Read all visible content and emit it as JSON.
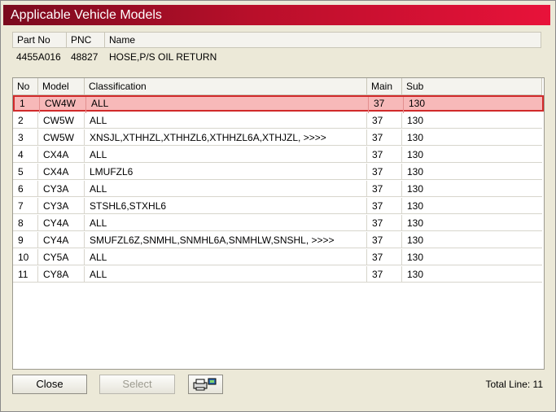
{
  "window": {
    "title": "Applicable Vehicle Models"
  },
  "part_info": {
    "headers": {
      "part_no": "Part No",
      "pnc": "PNC",
      "name": "Name"
    },
    "values": {
      "part_no": "4455A016",
      "pnc": "48827",
      "name": "HOSE,P/S OIL RETURN"
    }
  },
  "table": {
    "headers": {
      "no": "No",
      "model": "Model",
      "classification": "Classification",
      "main": "Main",
      "sub": "Sub"
    },
    "rows": [
      {
        "no": "1",
        "model": "CW4W",
        "classification": "ALL",
        "main": "37",
        "sub": "130"
      },
      {
        "no": "2",
        "model": "CW5W",
        "classification": "ALL",
        "main": "37",
        "sub": "130"
      },
      {
        "no": "3",
        "model": "CW5W",
        "classification": "XNSJL,XTHHZL,XTHHZL6,XTHHZL6A,XTHJZL,   >>>>",
        "main": "37",
        "sub": "130"
      },
      {
        "no": "4",
        "model": "CX4A",
        "classification": "ALL",
        "main": "37",
        "sub": "130"
      },
      {
        "no": "5",
        "model": "CX4A",
        "classification": "LMUFZL6",
        "main": "37",
        "sub": "130"
      },
      {
        "no": "6",
        "model": "CY3A",
        "classification": "ALL",
        "main": "37",
        "sub": "130"
      },
      {
        "no": "7",
        "model": "CY3A",
        "classification": "STSHL6,STXHL6",
        "main": "37",
        "sub": "130"
      },
      {
        "no": "8",
        "model": "CY4A",
        "classification": "ALL",
        "main": "37",
        "sub": "130"
      },
      {
        "no": "9",
        "model": "CY4A",
        "classification": "SMUFZL6Z,SNMHL,SNMHL6A,SNMHLW,SNSHL,   >>>>",
        "main": "37",
        "sub": "130"
      },
      {
        "no": "10",
        "model": "CY5A",
        "classification": "ALL",
        "main": "37",
        "sub": "130"
      },
      {
        "no": "11",
        "model": "CY8A",
        "classification": "ALL",
        "main": "37",
        "sub": "130"
      }
    ]
  },
  "footer": {
    "close_label": "Close",
    "select_label": "Select",
    "printer_icon": "printer-icon",
    "total_line": "Total Line: 11"
  },
  "colors": {
    "title_start": "#7a0a1e",
    "title_end": "#e8123a",
    "selected_row_bg": "#f7b9b9",
    "selected_row_border": "#d12a2a"
  }
}
